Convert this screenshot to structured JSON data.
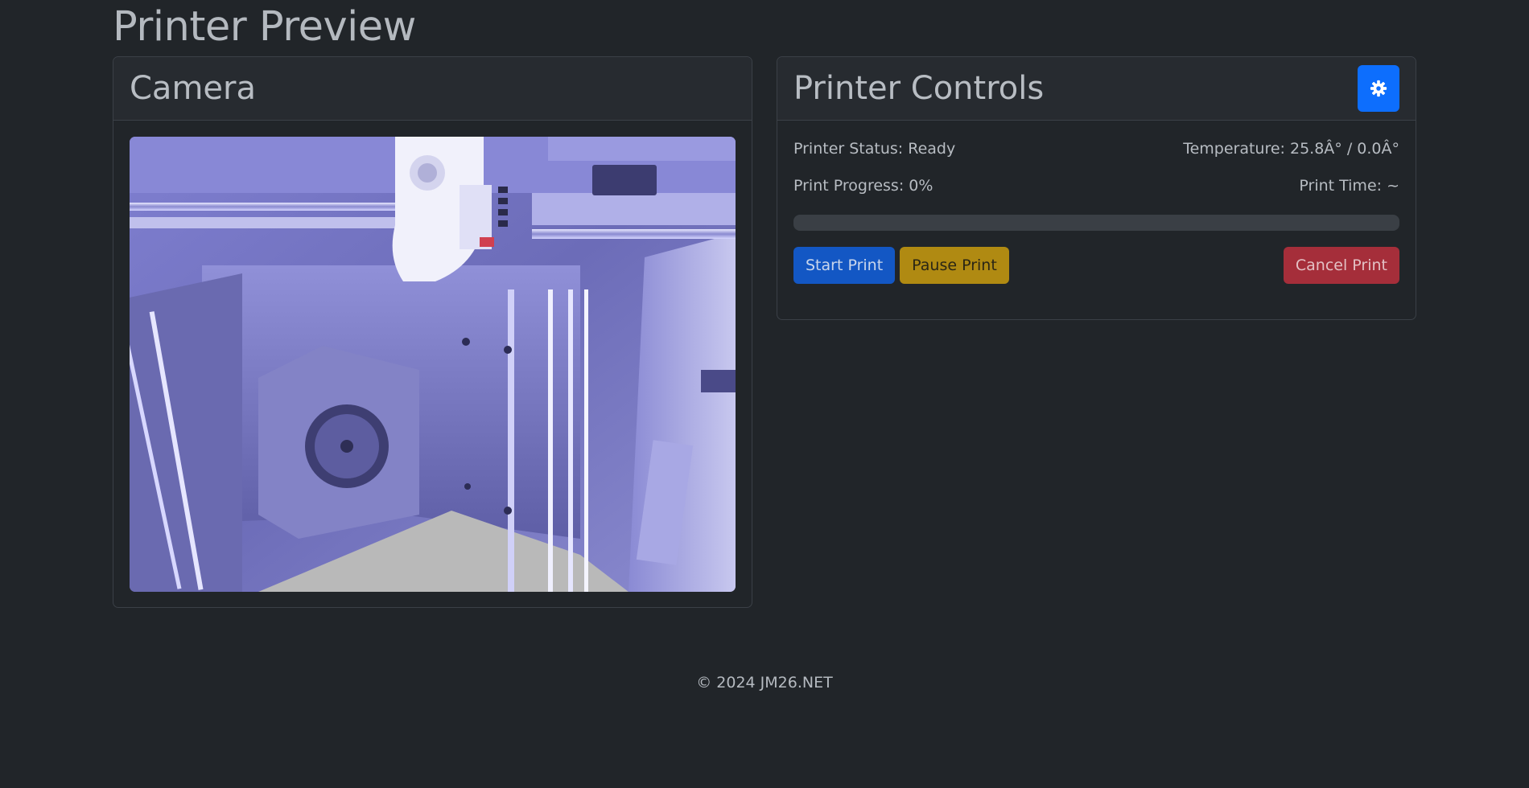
{
  "page": {
    "title": "Printer Preview"
  },
  "camera": {
    "title": "Camera",
    "feed_alt": "Printer camera feed"
  },
  "controls": {
    "title": "Printer Controls",
    "settings_icon": "gear-icon",
    "status_text": "Printer Status: Ready",
    "temperature_text": "Temperature: 25.8Â° / 0.0Â°",
    "progress_text": "Print Progress: 0%",
    "print_time_text": "Print Time: ~",
    "progress_value": 0,
    "buttons": {
      "start": "Start Print",
      "pause": "Pause Print",
      "cancel": "Cancel Print"
    }
  },
  "footer": {
    "text": "© 2024 JM26.NET"
  },
  "colors": {
    "background": "#212529",
    "primary": "#0d6efd",
    "start": "#1357c4",
    "pause": "#b08a12",
    "cancel": "#a52e3a"
  }
}
